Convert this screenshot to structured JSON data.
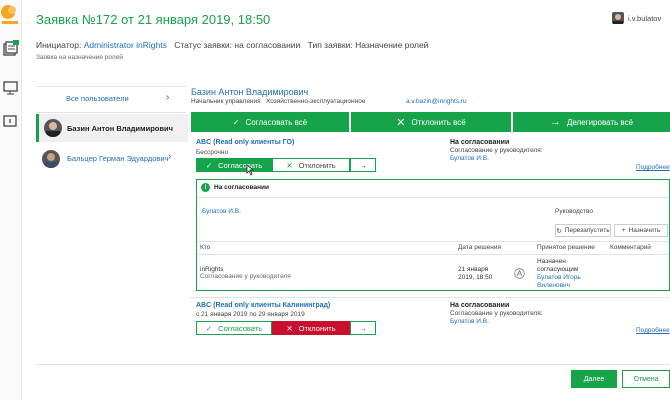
{
  "header": {
    "title": "Заявка №172 от 21 января 2019, 18:50",
    "user": "i.v.bulatov"
  },
  "info": {
    "initiator_label": "Инициатор:",
    "initiator_value": "Administrator inRights",
    "status_label": "Статус заявки:",
    "status_value": "на согласовании",
    "type_label": "Тип заявки:",
    "type_value": "Назначение ролей",
    "subtitle": "Заявка на назначение ролей"
  },
  "people": {
    "all_users": "Все пользователи",
    "items": [
      {
        "name": "Базин Антон Владимирович",
        "active": true
      },
      {
        "name": "Бальцер Герман Эдуардович",
        "active": false
      }
    ]
  },
  "person": {
    "name": "Базин Антон Владимирович",
    "position": "Начальник управления",
    "department": "Хозяйственно-эксплуатационное",
    "email": "a.v.bazin@inrights.ru"
  },
  "actions": {
    "approve_all": "Согласовать всё",
    "reject_all": "Отклонить всё",
    "delegate_all": "Делегировать всё"
  },
  "role1": {
    "title": "ABC (Read only клиенты ГО)",
    "period": "Бессрочно",
    "approve": "Согласовать",
    "reject": "Отклонить",
    "status": "На согласовании",
    "approval_label": "Согласование у руководителя:",
    "approver": "Булатов И.В.",
    "details": "Подробнее"
  },
  "panel": {
    "title": "На согласовании",
    "approver": "Булатов И.В.",
    "role": "Руководство",
    "restart": "Перезапустить",
    "assign": "Назначить",
    "columns": {
      "who": "Кто",
      "date": "Дата решения",
      "decision": "Принятое решение",
      "comment": "Комментарий"
    },
    "row": {
      "who": "inRights",
      "who_sub": "Согласование у руководителя",
      "date": "21 января 2019, 18:50",
      "decision": "Назначен согласующим",
      "decision_person": "Булатов Игорь Виленович"
    }
  },
  "role2": {
    "title": "ABC (Read only клиенты Калининград)",
    "period": "с 21 января 2019 по 29 января 2019",
    "approve": "Согласовать",
    "reject": "Отклонить",
    "status": "На согласовании",
    "approval_label": "Согласование у руководителя:",
    "approver": "Булатов И.В.",
    "details": "Подробнее"
  },
  "footer": {
    "next": "Далее",
    "cancel": "Отмена"
  },
  "colors": {
    "accent": "#16a34a",
    "danger": "#c8102e",
    "link": "#1f6fb2"
  }
}
